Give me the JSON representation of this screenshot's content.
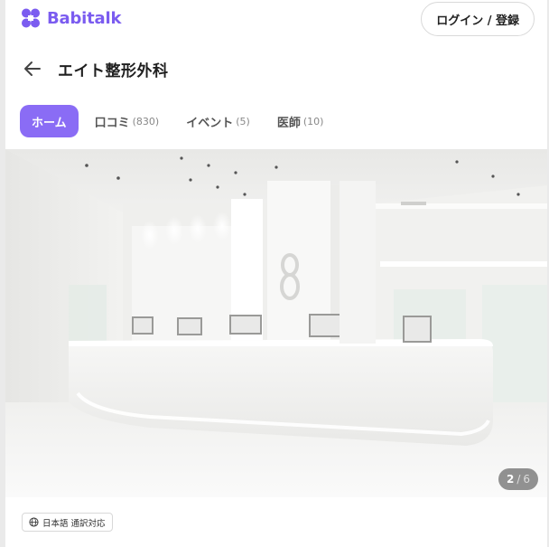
{
  "header": {
    "brand": "Babitalk",
    "login_label": "ログイン / 登録",
    "brand_color": "#7b5cf0"
  },
  "clinic": {
    "title": "エイト整形外科"
  },
  "tabs": [
    {
      "label": "ホーム",
      "count": "",
      "active": true
    },
    {
      "label": "口コミ",
      "count": "(830)",
      "active": false
    },
    {
      "label": "イベント",
      "count": "(5)",
      "active": false
    },
    {
      "label": "医師",
      "count": "(10)",
      "active": false
    }
  ],
  "gallery": {
    "current": "2",
    "separator": "/",
    "total": "6"
  },
  "badge": {
    "label": "日本語 通訳対応",
    "icon": "globe-icon"
  },
  "accent_color": "#8a6cf5"
}
